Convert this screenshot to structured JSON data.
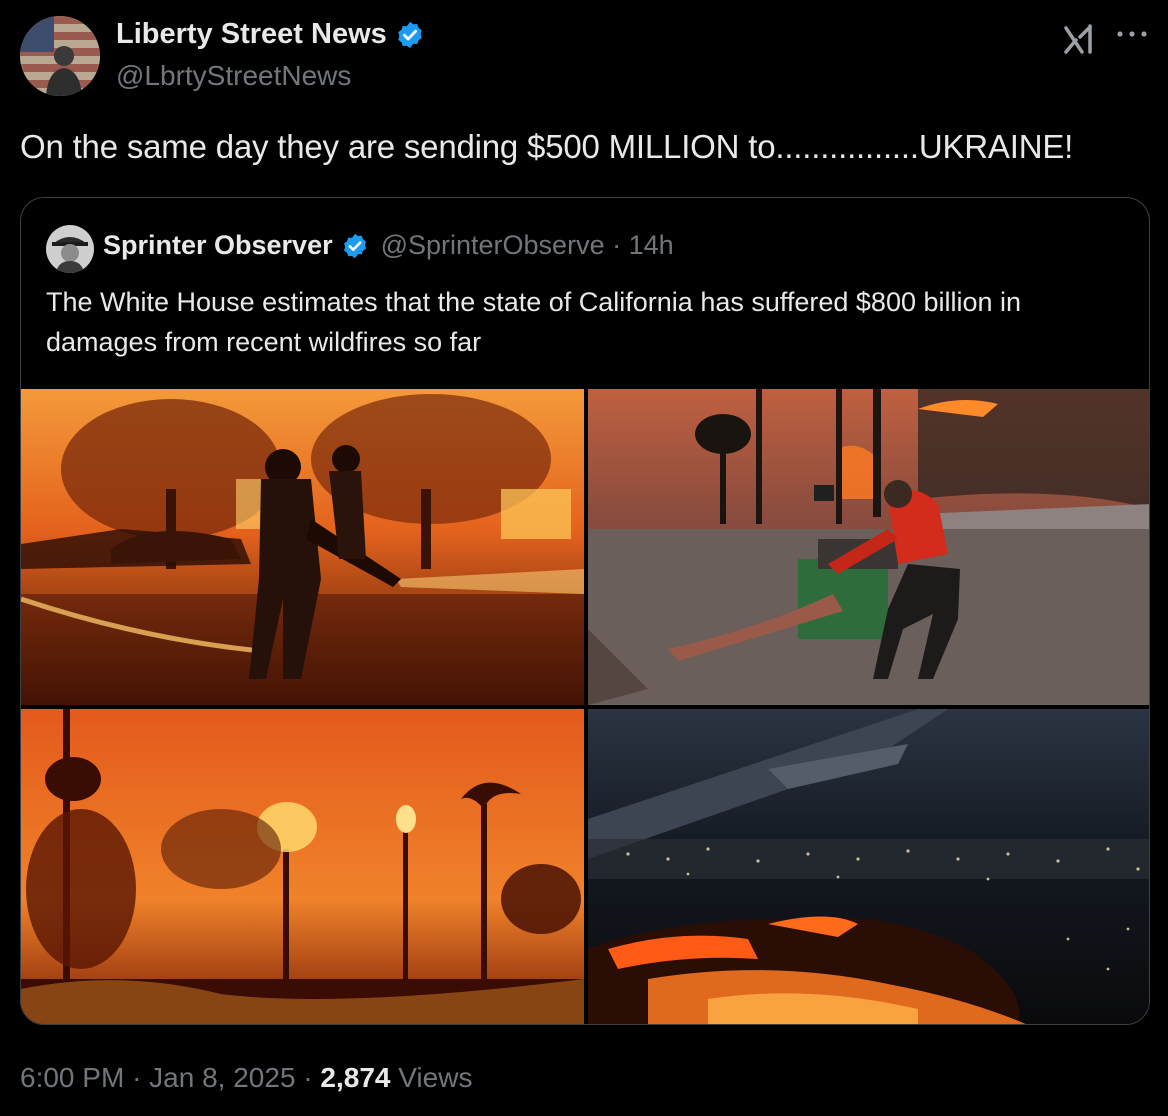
{
  "author": {
    "name": "Liberty Street News",
    "handle": "@LbrtyStreetNews"
  },
  "tweet": {
    "text": "On the same day they are sending $500 MILLION to................UKRAINE!"
  },
  "quote": {
    "name": "Sprinter Observer",
    "handle": "@SprinterObserve",
    "separator": "·",
    "time": "14h",
    "text": "The White House estimates that the state of California has suffered $800 billion in damages from recent wildfires so far"
  },
  "media": [
    {
      "icon": "firefighter-photo"
    },
    {
      "icon": "woman-pushing-cart-photo"
    },
    {
      "icon": "burning-palms-photo"
    },
    {
      "icon": "aerial-fire-photo"
    }
  ],
  "footer": {
    "time": "6:00 PM",
    "sep1": "·",
    "date": "Jan 8, 2025",
    "sep2": "·",
    "views_count": "2,874",
    "views_label": "Views"
  },
  "icons": {
    "verified": "verified-badge-icon",
    "grok": "grok-icon",
    "more": "more-icon"
  },
  "colors": {
    "background": "#000000",
    "text": "#e7e9ea",
    "secondary": "#71767b",
    "verified": "#1d9bf0",
    "border": "#3c4045"
  }
}
